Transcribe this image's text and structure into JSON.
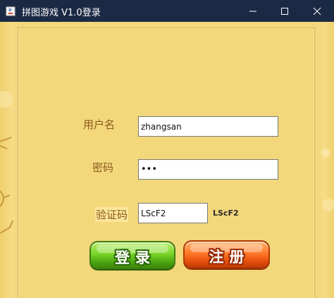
{
  "window": {
    "title": "拼图游戏 V1.0登录",
    "icon": "java-cup-icon"
  },
  "form": {
    "username_label": "用户名",
    "username_value": "zhangsan",
    "password_label": "密码",
    "password_value": "•••",
    "captcha_label": "验证码",
    "captcha_value": "LScF2",
    "captcha_code": "LScF2"
  },
  "buttons": {
    "login_label": "登录",
    "register_label": "注册"
  },
  "colors": {
    "background": "#f4d77c",
    "label": "#8b5a1c",
    "login_button": "#7cd62a",
    "register_button": "#ff7a2a"
  }
}
